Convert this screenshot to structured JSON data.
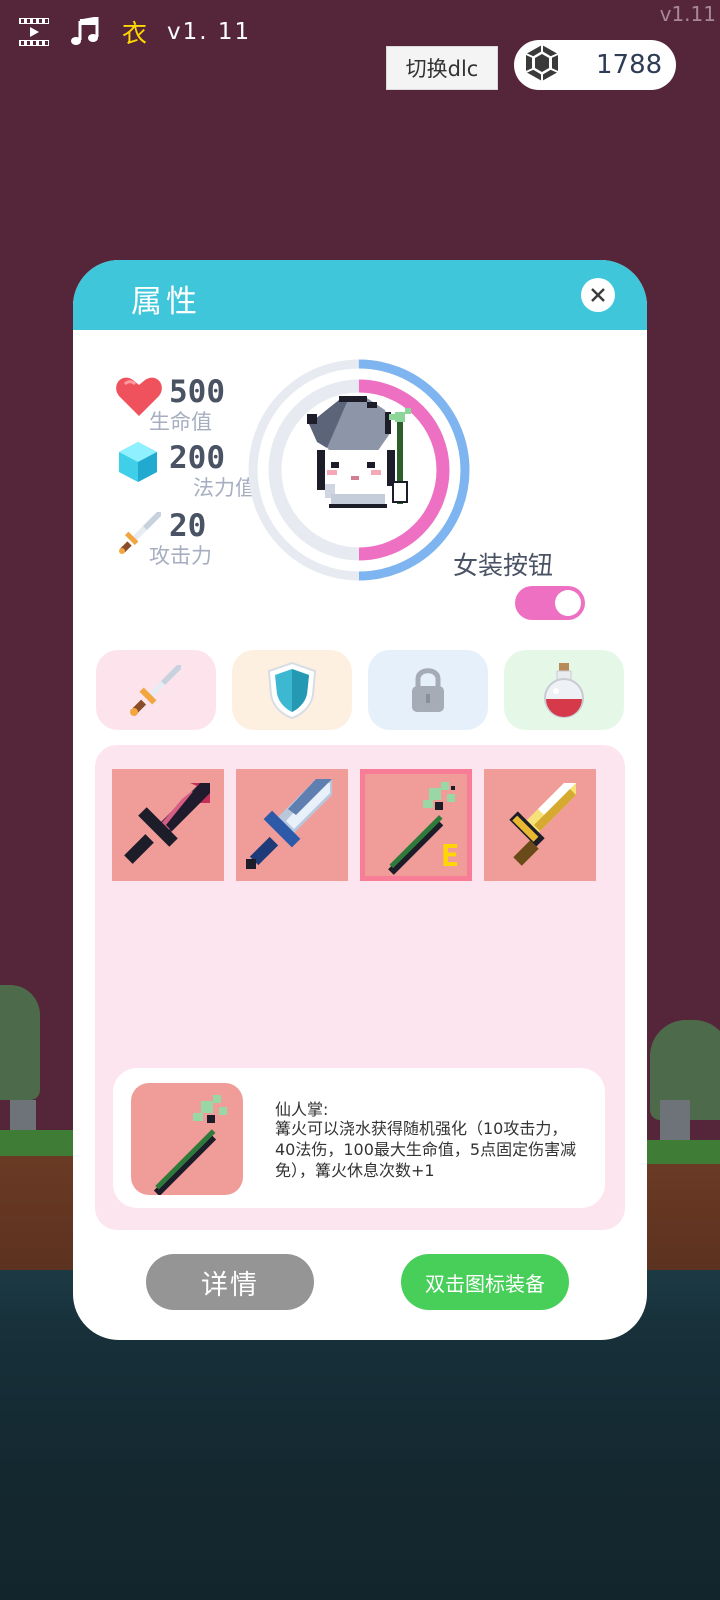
{
  "hud": {
    "cloth_label": "衣",
    "version": "v1. 11",
    "corner_version": "v1.11",
    "icons": [
      "film-icon",
      "music-note-icon"
    ]
  },
  "dlc_button": "切换dlc",
  "currency": {
    "icon": "gem-icon",
    "amount": "1788"
  },
  "panel": {
    "title": "属性",
    "stats": [
      {
        "icon": "heart-icon",
        "value": "500",
        "label": "生命值"
      },
      {
        "icon": "crystal-icon",
        "value": "200",
        "label": "法力值"
      },
      {
        "icon": "sword-icon",
        "value": "20",
        "label": "攻击力"
      }
    ],
    "hp_ring_fraction": 0.5,
    "mp_ring_fraction": 0.5,
    "toggle": {
      "label": "女装按钮",
      "on": true
    },
    "tabs": [
      {
        "icon": "sword-icon"
      },
      {
        "icon": "shield-icon"
      },
      {
        "icon": "lock-icon"
      },
      {
        "icon": "potion-icon"
      }
    ],
    "inventory": [
      {
        "icon": "dark-sword-icon"
      },
      {
        "icon": "ice-sword-icon"
      },
      {
        "icon": "cactus-staff-icon",
        "mark": "E",
        "selected": true
      },
      {
        "icon": "golden-sword-icon"
      }
    ],
    "selected_item": {
      "name": "仙人掌:",
      "description": "篝火可以浇水获得随机强化（10攻击力，40法伤，100最大生命值，5点固定伤害减免），篝火休息次数+1"
    },
    "detail_button": "详情",
    "equip_button": "双击图标装备"
  },
  "colors": {
    "background": "#55263a",
    "header": "#3fc6da",
    "toggle_on": "#ee70c3",
    "equip_button": "#48cf5a",
    "detail_button": "#959595",
    "slot_bg": "#f09c98"
  }
}
